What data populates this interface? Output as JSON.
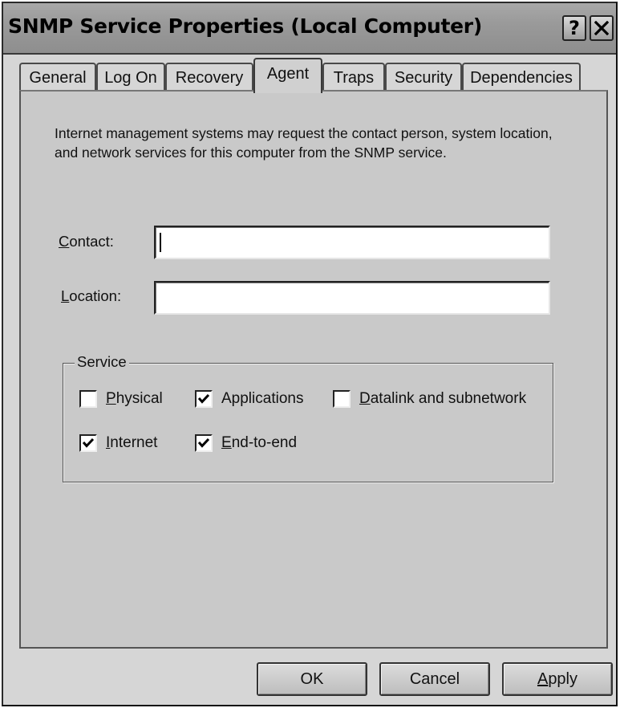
{
  "window": {
    "title": "SNMP Service Properties (Local Computer)",
    "help_glyph": "?",
    "close_glyph": "✕"
  },
  "tabs": [
    {
      "label": "General",
      "active": false
    },
    {
      "label": "Log On",
      "active": false
    },
    {
      "label": "Recovery",
      "active": false
    },
    {
      "label": "Agent",
      "active": true
    },
    {
      "label": "Traps",
      "active": false
    },
    {
      "label": "Security",
      "active": false
    },
    {
      "label": "Dependencies",
      "active": false
    }
  ],
  "agent": {
    "description": "Internet management systems may request the contact person, system location, and network services for this computer from the SNMP service.",
    "contact": {
      "label_mnemonic": "C",
      "label_rest": "ontact:",
      "value": ""
    },
    "location": {
      "label_mnemonic": "L",
      "label_rest": "ocation:",
      "value": ""
    },
    "service": {
      "legend": "Service",
      "options": [
        {
          "mnemonic": "P",
          "rest": "hysical",
          "checked": false
        },
        {
          "mnemonic": "",
          "rest": "Applications",
          "checked": true
        },
        {
          "mnemonic": "D",
          "rest": "atalink and subnetwork",
          "checked": false
        },
        {
          "mnemonic": "I",
          "rest": "nternet",
          "checked": true
        },
        {
          "mnemonic": "E",
          "rest": "nd-to-end",
          "checked": true
        }
      ]
    }
  },
  "buttons": {
    "ok": "OK",
    "cancel": "Cancel",
    "apply_mnemonic": "A",
    "apply_rest": "pply"
  },
  "icons": {
    "help": "help-icon",
    "close": "close-icon",
    "check": "checkmark-icon"
  }
}
